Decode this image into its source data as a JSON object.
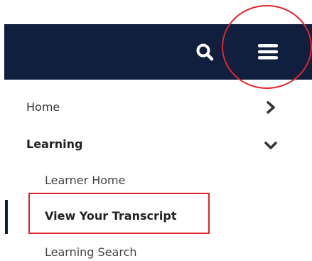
{
  "header": {
    "background": "#0f1f3d",
    "search_icon": "search-icon",
    "menu_icon": "hamburger-menu-icon"
  },
  "nav": {
    "home": {
      "label": "Home",
      "icon": "chevron-right-icon"
    },
    "learning": {
      "label": "Learning",
      "icon": "chevron-down-icon",
      "expanded": true,
      "items": [
        {
          "label": "Learner Home",
          "active": false
        },
        {
          "label": "View Your Transcript",
          "active": true
        },
        {
          "label": "Learning Search",
          "active": false
        }
      ]
    }
  },
  "annotations": {
    "highlight_color": "#e3242b"
  }
}
